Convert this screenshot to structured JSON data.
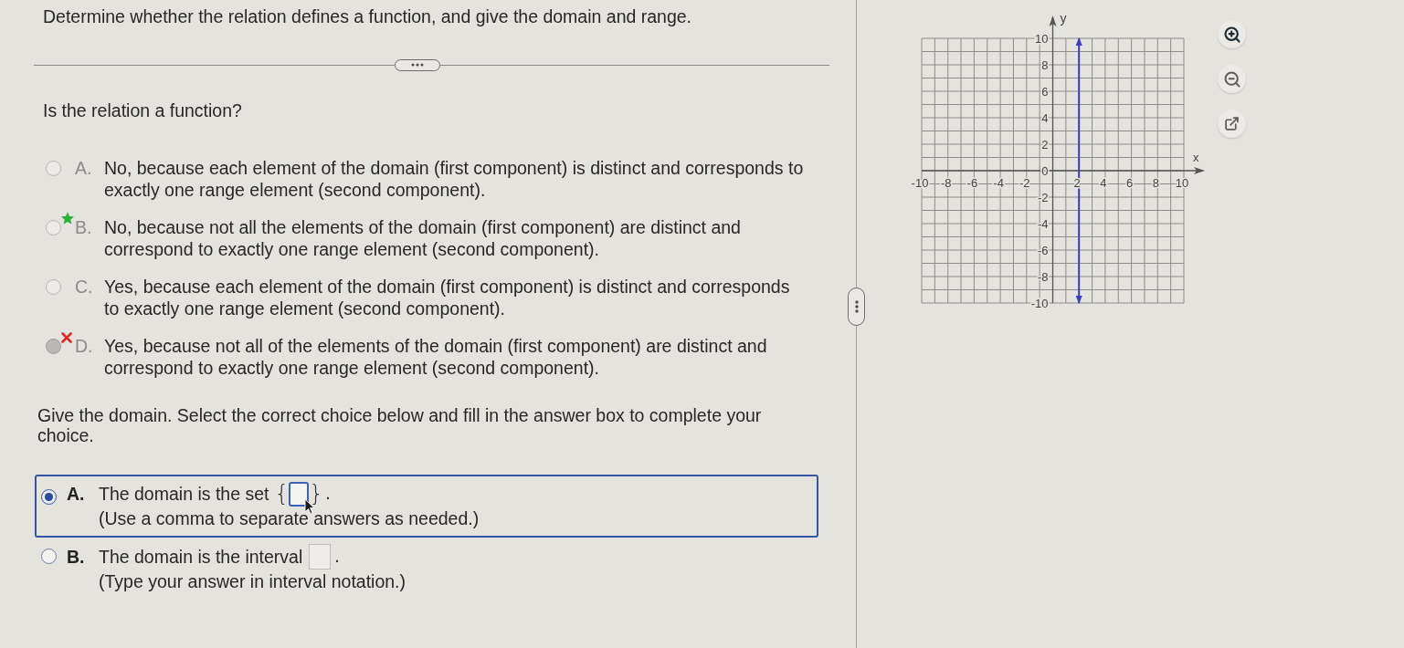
{
  "question": {
    "title": "Determine whether the relation defines a function, and give the domain and range."
  },
  "function_part": {
    "prompt": "Is the relation a function?",
    "locked": true,
    "options": [
      {
        "letter": "A.",
        "text": "No, because each element of the domain (first component) is distinct and corresponds to\nexactly one range element (second component).",
        "selected": false,
        "starred": false,
        "crossed": false
      },
      {
        "letter": "B.",
        "text": "No, because not all the elements of the domain (first component) are distinct and\ncorrespond to exactly one range element (second component).",
        "selected": false,
        "starred": true,
        "crossed": false
      },
      {
        "letter": "C.",
        "text": "Yes, because each element of the domain (first component) is distinct and corresponds\nto exactly one range element (second component).",
        "selected": false,
        "starred": false,
        "crossed": false
      },
      {
        "letter": "D.",
        "text": "Yes, because not all of the elements of the domain (first component) are distinct and\ncorrespond to exactly one range element (second component).",
        "selected": true,
        "starred": false,
        "crossed": true
      }
    ]
  },
  "domain_part": {
    "prompt": "Give the domain. Select the correct choice below and fill in the answer box to complete your\nchoice.",
    "locked": false,
    "options": [
      {
        "kind": "set",
        "letter": "A.",
        "text": "The domain is the set",
        "open": "{",
        "close": "}",
        "end": ".",
        "hint": "(Use a comma to separate answers as needed.)",
        "selected": true
      },
      {
        "kind": "interval",
        "letter": "B.",
        "text": "The domain is the interval",
        "end": ".",
        "hint": "(Type your answer in interval notation.)",
        "selected": false
      }
    ]
  },
  "graph": {
    "chart_data": {
      "type": "line",
      "xlabel": "x",
      "ylabel": "y",
      "xlim": [
        -10,
        10
      ],
      "ylim": [
        -10,
        10
      ],
      "xticks": [
        -10,
        -8,
        -6,
        -4,
        -2,
        2,
        4,
        6,
        8,
        10
      ],
      "yticks": [
        10,
        8,
        6,
        4,
        2,
        0,
        -2,
        -4,
        -6,
        -8,
        -10
      ],
      "grid": true,
      "x": [
        2,
        2
      ],
      "series": [
        {
          "color": "#3b3bc4",
          "values": [
            -10,
            10
          ]
        }
      ]
    }
  }
}
